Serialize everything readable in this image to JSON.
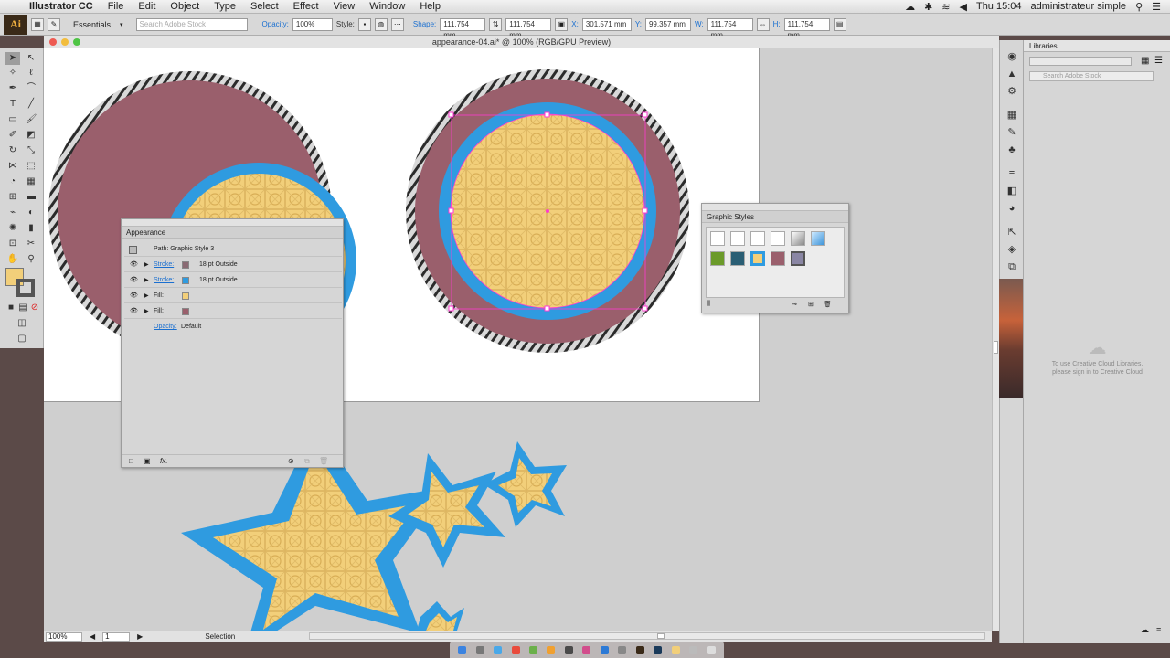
{
  "menubar": {
    "app_name": "Illustrator CC",
    "menus": [
      "File",
      "Edit",
      "Object",
      "Type",
      "Select",
      "Effect",
      "View",
      "Window",
      "Help"
    ],
    "clock": "Thu 15:04",
    "user": "administrateur simple"
  },
  "control_bar": {
    "workspace": "Essentials",
    "search_placeholder": "Search Adobe Stock",
    "opacity_label": "Opacity:",
    "opacity_value": "100%",
    "style_label": "Style:",
    "shape_label": "Shape:",
    "shape_w": "111,754 mm",
    "shape_h": "111,754 mm",
    "x_label": "X:",
    "x_value": "301,571 mm",
    "y_label": "Y:",
    "y_value": "99,357 mm",
    "w_label": "W:",
    "w_value": "111,754 mm",
    "h_label": "H:",
    "h_value": "111,754 mm"
  },
  "document": {
    "tab_title": "appearance-04.ai* @ 100% (RGB/GPU Preview)"
  },
  "status_bar": {
    "zoom": "100%",
    "artboard": "1",
    "tool": "Selection"
  },
  "appearance_panel": {
    "title": "Appearance",
    "header": "Path: Graphic Style 3",
    "rows": [
      {
        "label": "Stroke:",
        "value": "18 pt  Outside",
        "swatch": "#8a6a73"
      },
      {
        "label": "Stroke:",
        "value": "18 pt  Outside",
        "swatch": "#2f9be0"
      },
      {
        "label": "Fill:",
        "value": "",
        "swatch": "#f2cf7a"
      },
      {
        "label": "Fill:",
        "value": "",
        "swatch": "#9a5f6c"
      }
    ],
    "opacity_label": "Opacity:",
    "opacity_value": "Default",
    "fx_label": "fx."
  },
  "graphic_styles_panel": {
    "title": "Graphic Styles"
  },
  "libraries_panel": {
    "title": "Libraries",
    "search_placeholder": "Search Adobe Stock",
    "message_line1": "To use Creative Cloud Libraries,",
    "message_line2": "please sign in to Creative Cloud"
  },
  "colors": {
    "mauve": "#9a5f6c",
    "blue_stroke": "#2f9be0",
    "gold": "#f2cf7a",
    "selection": "#ff3ad1"
  }
}
